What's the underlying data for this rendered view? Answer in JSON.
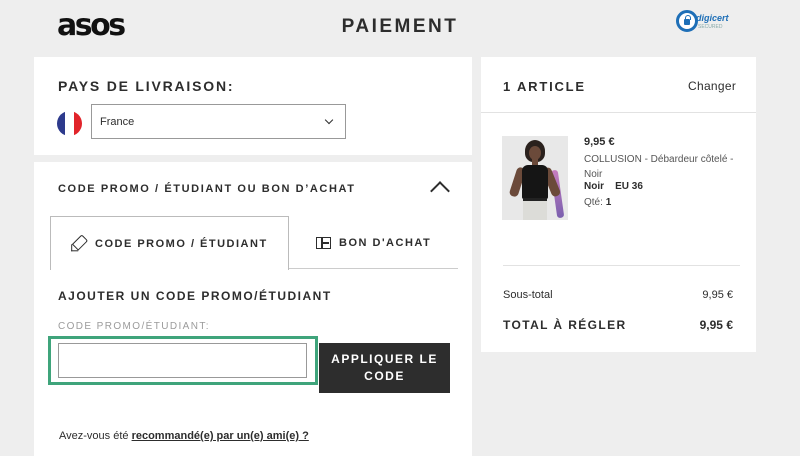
{
  "header": {
    "logo": "asos",
    "title": "PAIEMENT",
    "trust_badge": {
      "name": "digicert",
      "subtext": "SECURED"
    }
  },
  "delivery": {
    "heading": "PAYS DE LIVRAISON:",
    "selected_country": "France",
    "flag_colors": [
      "#2d3a8c",
      "#ffffff",
      "#e1242a"
    ]
  },
  "promo": {
    "heading": "CODE PROMO / ÉTUDIANT OU BON D’ACHAT",
    "tabs": [
      {
        "label": "CODE PROMO / ÉTUDIANT",
        "icon": "tag-icon",
        "active": true
      },
      {
        "label": "BON D'ACHAT",
        "icon": "voucher-icon",
        "active": false
      }
    ],
    "subheading": "AJOUTER UN CODE PROMO/ÉTUDIANT",
    "field_label": "CODE PROMO/ÉTUDIANT:",
    "input_value": "",
    "apply_label": "APPLIQUER LE CODE",
    "referral_prefix": "Avez-vous été ",
    "referral_link": "recommandé(e) par un(e) ami(e) ?",
    "focus_color": "#3fa47b"
  },
  "summary": {
    "heading": "1 ARTICLE",
    "change_label": "Changer",
    "item": {
      "price": "9,95 €",
      "name": "COLLUSION - Débardeur côtelé - Noir",
      "color": "Noir",
      "size": "EU 36",
      "qty_label": "Qté:",
      "qty": "1"
    },
    "subtotal_label": "Sous-total",
    "subtotal_value": "9,95 €",
    "total_label": "TOTAL À RÉGLER",
    "total_value": "9,95 €"
  }
}
